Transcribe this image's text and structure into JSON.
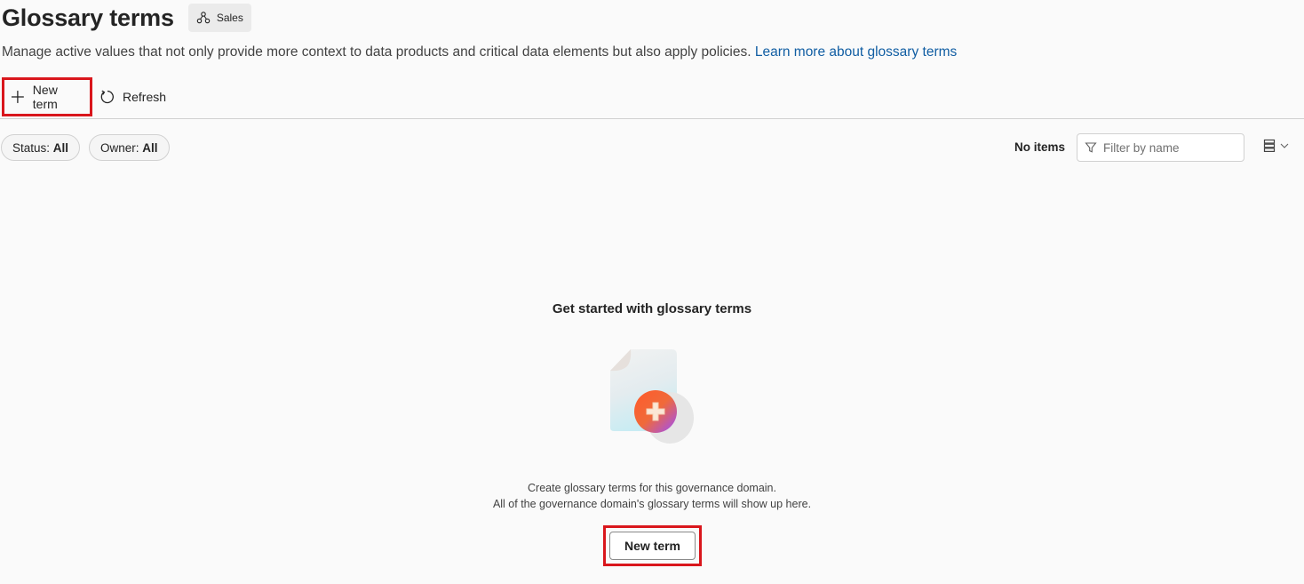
{
  "header": {
    "title": "Glossary terms",
    "domain_chip": {
      "label": "Sales",
      "icon": "domain-nodes-icon"
    }
  },
  "description": {
    "text": "Manage active values that not only provide more context to data products and critical data elements but also apply policies. ",
    "link": "Learn more about glossary terms"
  },
  "toolbar": {
    "new_term": {
      "label": "New term",
      "icon": "plus-icon"
    },
    "refresh": {
      "label": "Refresh",
      "icon": "refresh-icon"
    }
  },
  "filters": {
    "status": {
      "label": "Status: ",
      "value": "All"
    },
    "owner": {
      "label": "Owner: ",
      "value": "All"
    }
  },
  "results": {
    "count_label": "No items",
    "filter_placeholder": "Filter by name"
  },
  "empty_state": {
    "title": "Get started with glossary terms",
    "line1": "Create glossary terms for this governance domain.",
    "line2": "All of the governance domain's glossary terms will show up here.",
    "button": "New term"
  },
  "colors": {
    "highlight": "#d9161c",
    "link": "#115ea3"
  }
}
